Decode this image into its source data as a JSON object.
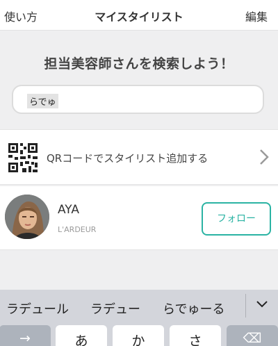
{
  "nav": {
    "left_label": "使い方",
    "title": "マイスタイリスト",
    "right_label": "編集"
  },
  "search": {
    "heading": "担当美容師さんを検索しよう！",
    "value": "らでゅ"
  },
  "qr": {
    "label": "QRコードでスタイリスト追加する",
    "icon": "qr-code-icon"
  },
  "stylist": {
    "name": "AYA",
    "salon": "L'ARDEUR",
    "follow_label": "フォロー"
  },
  "keyboard": {
    "suggestions": [
      "ラデュール",
      "ラデュー",
      "らでゅーる"
    ],
    "keys": [
      "→",
      "あ",
      "か",
      "さ",
      "⌫"
    ]
  },
  "colors": {
    "accent": "#2ab3a3",
    "background": "#efeff0"
  }
}
